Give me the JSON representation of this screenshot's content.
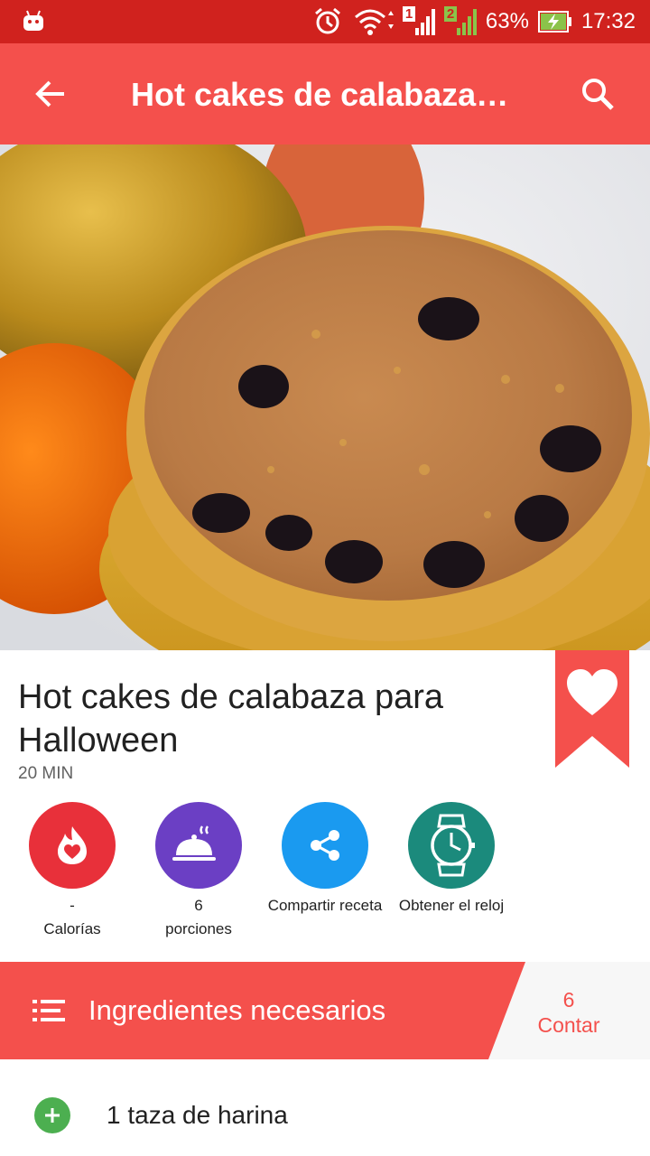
{
  "status_bar": {
    "battery_percent": "63%",
    "time": "17:32",
    "sim1_label": "1",
    "sim2_label": "2",
    "icons": [
      "android-icon",
      "alarm-icon",
      "wifi-icon",
      "signal-icon",
      "battery-charging-icon"
    ]
  },
  "app_bar": {
    "title": "Hot cakes de calabaza…",
    "back_icon": "arrow-back-icon",
    "search_icon": "search-icon"
  },
  "recipe": {
    "title": "Hot cakes de calabaza para Halloween",
    "time": "20 MIN",
    "favorite_icon": "heart-icon"
  },
  "stats": [
    {
      "value": "-",
      "label": "Calorías",
      "icon": "flame-heart-icon",
      "color": "#e8303a"
    },
    {
      "value": "6",
      "label": "porciones",
      "icon": "serving-cloche-icon",
      "color": "#6b3fc4"
    },
    {
      "value": "",
      "label": "Compartir receta",
      "icon": "share-icon",
      "color": "#1a9af0"
    },
    {
      "value": "",
      "label": "Obtener el reloj",
      "icon": "watch-icon",
      "color": "#1b8a7c"
    }
  ],
  "ingredients": {
    "header_label": "Ingredientes necesarios",
    "count_value": "6",
    "count_label": "Contar",
    "items": [
      {
        "text": "1 taza de harina"
      }
    ]
  },
  "colors": {
    "status_bar": "#d0221e",
    "primary": "#f4504c",
    "add_green": "#4caf50"
  }
}
